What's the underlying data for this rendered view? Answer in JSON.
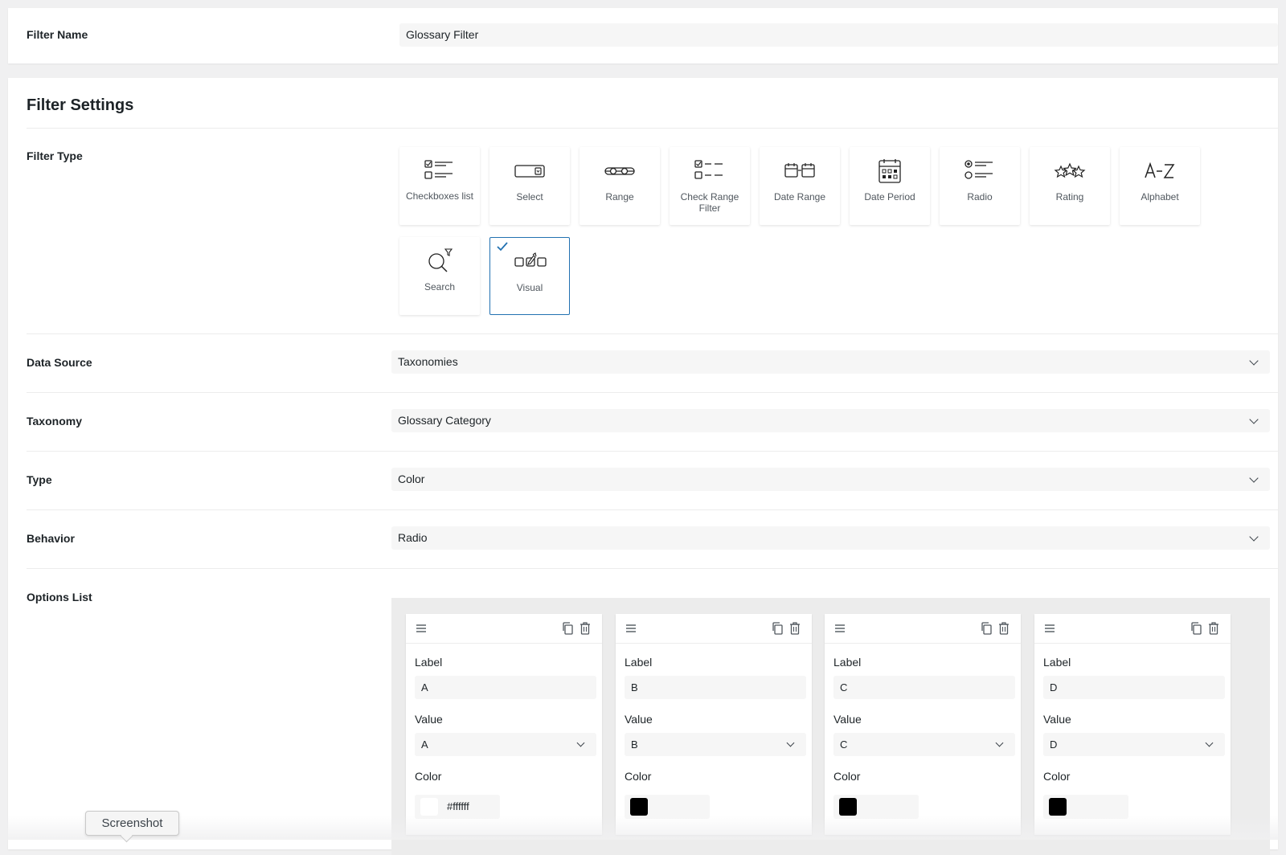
{
  "filter_name": {
    "label": "Filter Name",
    "value": "Glossary Filter"
  },
  "settings": {
    "title": "Filter Settings",
    "filter_type": {
      "label": "Filter Type",
      "selected": "Visual",
      "types": [
        {
          "label": "Checkboxes list",
          "icon": "checkboxes-list-icon"
        },
        {
          "label": "Select",
          "icon": "select-icon"
        },
        {
          "label": "Range",
          "icon": "range-icon"
        },
        {
          "label": "Check Range Filter",
          "icon": "check-range-filter-icon"
        },
        {
          "label": "Date Range",
          "icon": "date-range-icon"
        },
        {
          "label": "Date Period",
          "icon": "date-period-icon"
        },
        {
          "label": "Radio",
          "icon": "radio-icon"
        },
        {
          "label": "Rating",
          "icon": "rating-icon"
        },
        {
          "label": "Alphabet",
          "icon": "alphabet-icon"
        },
        {
          "label": "Search",
          "icon": "search-icon"
        },
        {
          "label": "Visual",
          "icon": "visual-icon"
        }
      ]
    },
    "data_source": {
      "label": "Data Source",
      "value": "Taxonomies"
    },
    "taxonomy": {
      "label": "Taxonomy",
      "value": "Glossary Category"
    },
    "type": {
      "label": "Type",
      "value": "Color"
    },
    "behavior": {
      "label": "Behavior",
      "value": "Radio"
    },
    "options_list": {
      "label": "Options List",
      "field_labels": {
        "label": "Label",
        "value": "Value",
        "color": "Color"
      },
      "options": [
        {
          "label": "A",
          "value": "A",
          "color": "#ffffff",
          "color_text": "#ffffff"
        },
        {
          "label": "B",
          "value": "B",
          "color": "#000000",
          "color_text": ""
        },
        {
          "label": "C",
          "value": "C",
          "color": "#000000",
          "color_text": ""
        },
        {
          "label": "D",
          "value": "D",
          "color": "#000000",
          "color_text": ""
        }
      ]
    }
  },
  "tooltip": {
    "text": "Screenshot"
  },
  "colors": {
    "accent": "#2271b1",
    "field_bg": "#f6f6f6"
  }
}
